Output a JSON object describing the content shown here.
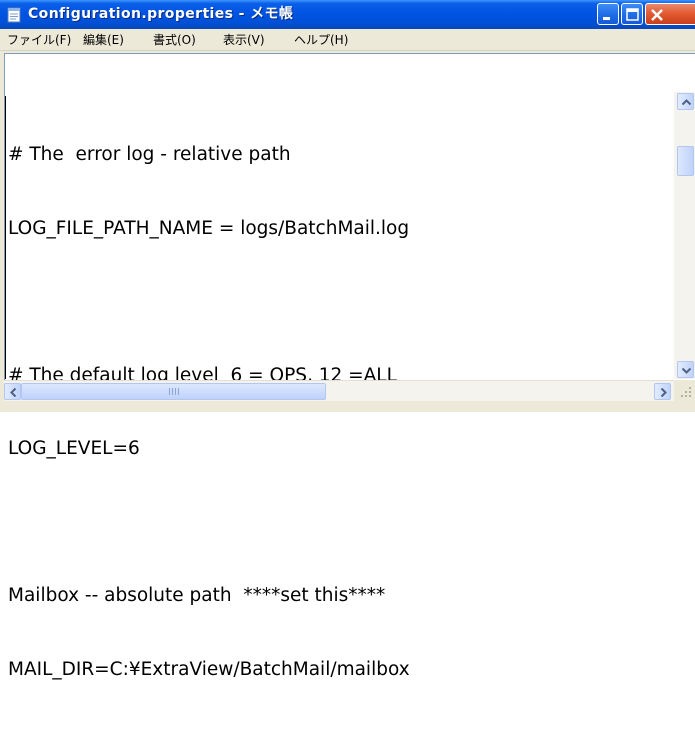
{
  "window": {
    "title": "Configuration.properties - メモ帳"
  },
  "menu": [
    {
      "label": "ファイル(F)"
    },
    {
      "label": "編集(E)"
    },
    {
      "label": "書式(O)"
    },
    {
      "label": "表示(V)"
    },
    {
      "label": "ヘルプ(H)"
    }
  ],
  "editor": {
    "lines": [
      "# The  error log - relative path",
      "LOG_FILE_PATH_NAME = logs/BatchMail.log",
      "",
      "# The default log level  6 = OPS, 12 =ALL",
      "LOG_LEVEL=6",
      "",
      "Mailbox -- absolute path  ****set this****",
      "MAIL_DIR=C:¥ExtraView/BatchMail/mailbox"
    ]
  },
  "icons": {
    "app": "notepad-icon",
    "minimize": "minimize-icon",
    "maximize": "maximize-icon",
    "close": "close-icon",
    "scroll_up": "arrow-up-icon",
    "scroll_down": "arrow-down-icon",
    "scroll_left": "arrow-left-icon",
    "scroll_right": "arrow-right-icon"
  },
  "colors": {
    "titlebar": "#0054e3",
    "close_button": "#e2582f",
    "scrollbar": "#c1d3fb"
  }
}
